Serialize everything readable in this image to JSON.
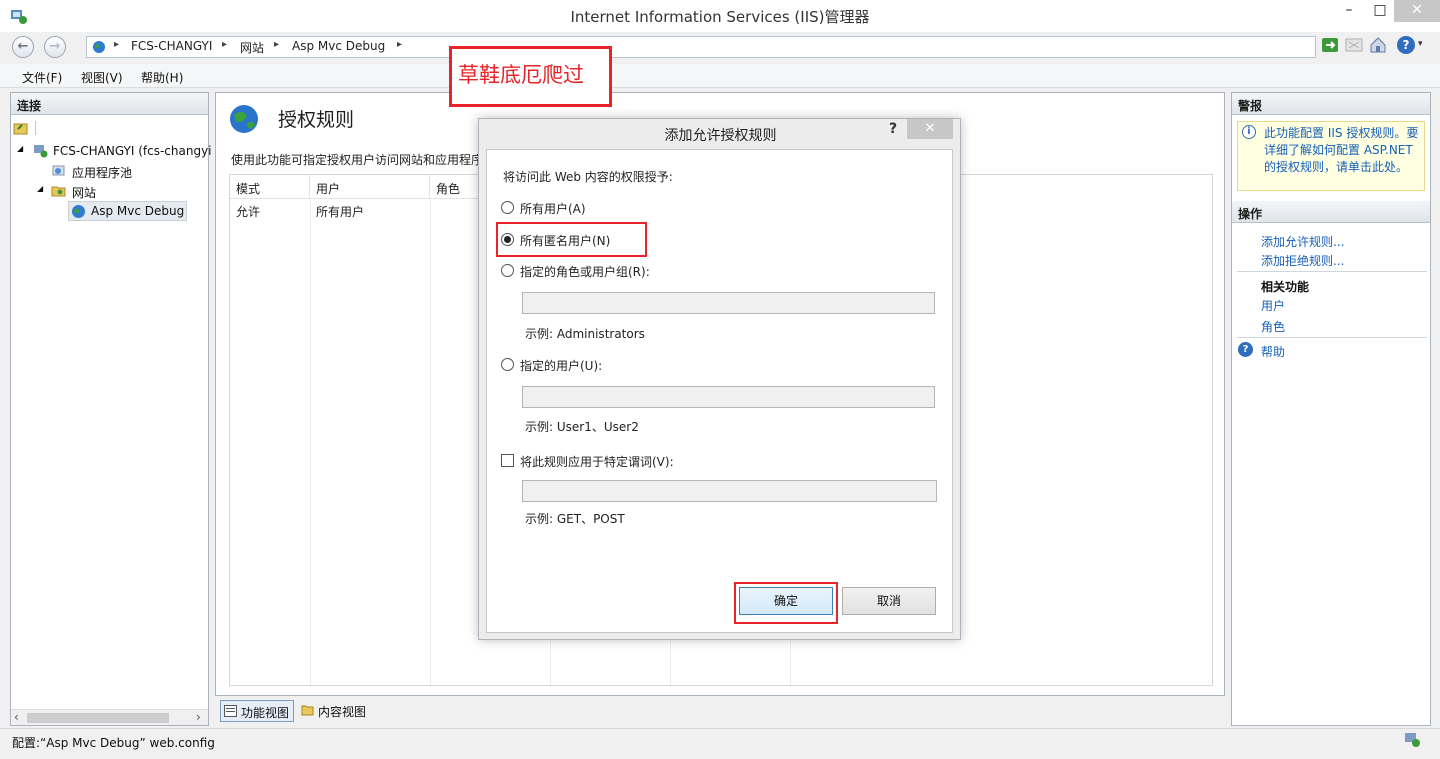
{
  "window": {
    "title": "Internet Information Services (IIS)管理器",
    "min": "–",
    "max": "□",
    "close": "✕"
  },
  "breadcrumbs": [
    "FCS-CHANGYI",
    "网站",
    "Asp Mvc Debug"
  ],
  "nav": {
    "back": "←",
    "forward": "→",
    "sep": "▸",
    "help": "?",
    "help_arrow": "▾"
  },
  "menu": [
    "文件(F)",
    "视图(V)",
    "帮助(H)"
  ],
  "annotation": "草鞋底厄爬过",
  "connections": {
    "header": "连接",
    "tree": [
      {
        "label": "FCS-CHANGYI (fcs-changyi",
        "toggle": "◢"
      },
      {
        "label": "应用程序池"
      },
      {
        "label": "网站",
        "toggle": "◢"
      },
      {
        "label": "Asp Mvc Debug"
      }
    ],
    "scroll_left": "‹",
    "scroll_right": "›"
  },
  "main": {
    "title": "授权规则",
    "description": "使用此功能可指定授权用户访问网站和应用程序",
    "columns": [
      "模式",
      "用户",
      "角色"
    ],
    "rows": [
      {
        "mode": "允许",
        "user": "所有用户"
      }
    ]
  },
  "view_tabs": [
    "功能视图",
    "内容视图"
  ],
  "alerts": {
    "header": "警报",
    "text": "此功能配置 IIS 授权规则。要详细了解如何配置 ASP.NET 的授权规则，请单击此处。",
    "icon": "i"
  },
  "actions": {
    "header": "操作",
    "add_allow": "添加允许规则...",
    "add_deny": "添加拒绝规则...",
    "related_header": "相关功能",
    "users": "用户",
    "roles": "角色",
    "help": "帮助",
    "help_icon": "?"
  },
  "status": "配置:“Asp Mvc Debug” web.config",
  "dialog": {
    "title": "添加允许授权规则",
    "help": "?",
    "close": "✕",
    "prompt": "将访问此 Web 内容的权限授予:",
    "option_all": "所有用户(A)",
    "option_anonymous": "所有匿名用户(N)",
    "option_roles": "指定的角色或用户组(R):",
    "roles_value": "",
    "roles_example": "示例: Administrators",
    "option_users": "指定的用户(U):",
    "users_value": "",
    "users_example": "示例: User1、User2",
    "verbs_check": "将此规则应用于特定谓词(V):",
    "verbs_value": "",
    "verbs_example": "示例: GET、POST",
    "selected": "anonymous",
    "ok": "确定",
    "cancel": "取消"
  },
  "colors": {
    "highlight": "#e8242a",
    "link": "#1660b8"
  }
}
